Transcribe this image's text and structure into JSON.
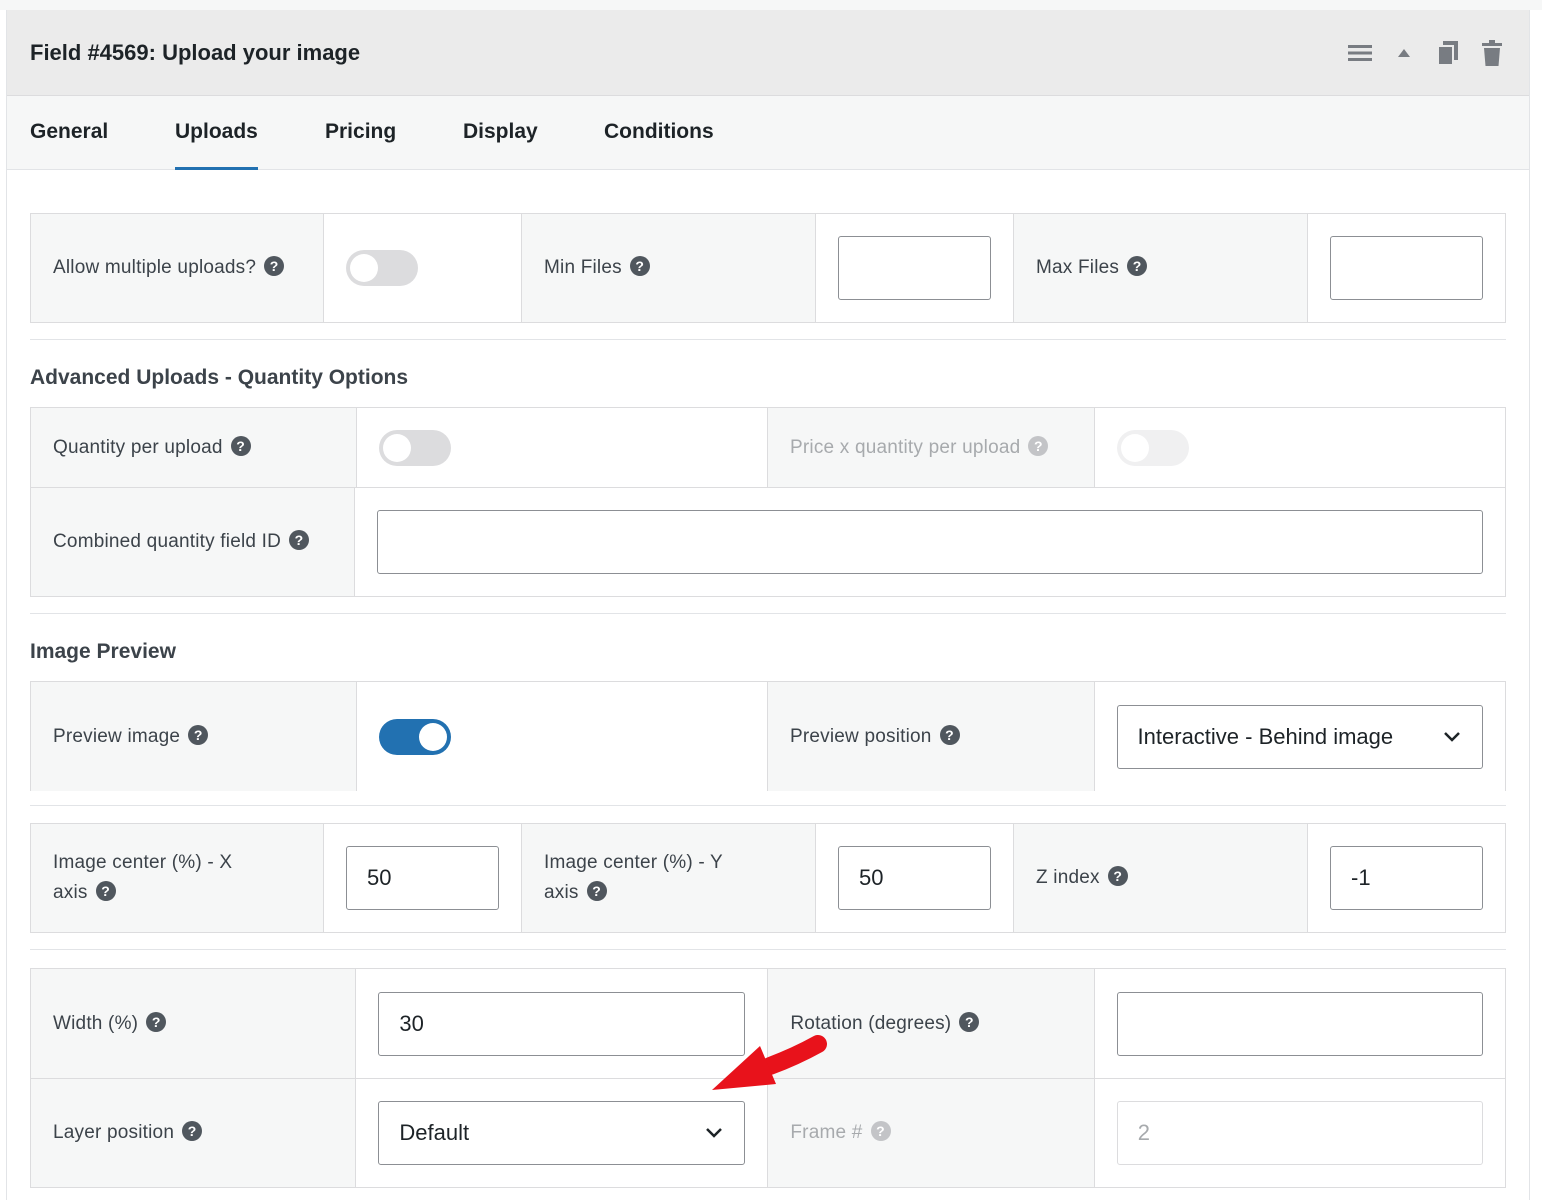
{
  "header": {
    "title": "Field #4569: Upload your image",
    "icons": [
      "menu-icon",
      "collapse-up-icon",
      "duplicate-icon",
      "trash-icon"
    ]
  },
  "tabs": [
    {
      "label": "General",
      "active": false
    },
    {
      "label": "Uploads",
      "active": true
    },
    {
      "label": "Pricing",
      "active": false
    },
    {
      "label": "Display",
      "active": false
    },
    {
      "label": "Conditions",
      "active": false
    }
  ],
  "uploads": {
    "allow_multiple": {
      "label": "Allow multiple uploads?",
      "on": false
    },
    "min_files": {
      "label": "Min Files",
      "value": ""
    },
    "max_files": {
      "label": "Max Files",
      "value": ""
    }
  },
  "advanced": {
    "title": "Advanced Uploads - Quantity Options",
    "quantity_per_upload": {
      "label": "Quantity per upload",
      "on": false
    },
    "price_x_quantity": {
      "label": "Price x quantity per upload",
      "on": false
    },
    "combined_field": {
      "label": "Combined quantity field ID",
      "value": ""
    }
  },
  "preview": {
    "title": "Image Preview",
    "preview_image": {
      "label": "Preview image",
      "on": true
    },
    "preview_position": {
      "label": "Preview position",
      "value": "Interactive - Behind image"
    },
    "center_x": {
      "label_line1": "Image center (%) - X",
      "label_line2": "axis",
      "value": "50"
    },
    "center_y": {
      "label_line1": "Image center (%) - Y",
      "label_line2": "axis",
      "value": "50"
    },
    "z_index": {
      "label": "Z index",
      "value": "-1"
    },
    "width": {
      "label": "Width (%)",
      "value": "30"
    },
    "rotation": {
      "label": "Rotation (degrees)",
      "value": ""
    },
    "layer_position": {
      "label": "Layer position",
      "value": "Default"
    },
    "frame": {
      "label": "Frame #",
      "value": "2"
    }
  },
  "help_glyph": "?",
  "colors": {
    "accent": "#2271b1",
    "annotation_arrow": "#e8121b"
  }
}
